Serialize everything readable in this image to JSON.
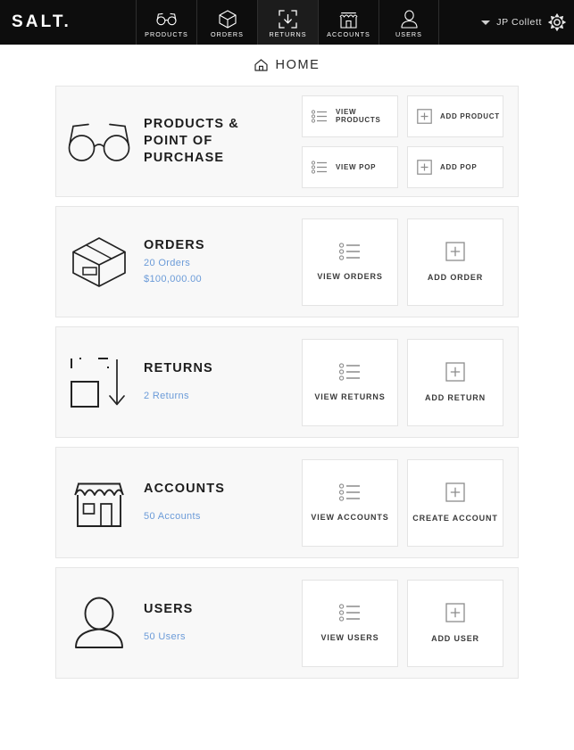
{
  "topnav": {
    "logo": "SALT.",
    "items": [
      {
        "label": "PRODUCTS",
        "icon": "glasses-icon",
        "active": false
      },
      {
        "label": "ORDERS",
        "icon": "box-icon",
        "active": false
      },
      {
        "label": "RETURNS",
        "icon": "return-box-icon",
        "active": true
      },
      {
        "label": "ACCOUNTS",
        "icon": "storefront-icon",
        "active": false
      },
      {
        "label": "USERS",
        "icon": "person-icon",
        "active": false
      }
    ],
    "username": "JP Collett",
    "settings_icon": "gear-icon",
    "chevron_icon": "chevron-down-icon"
  },
  "breadcrumb": {
    "icon": "home-icon",
    "label": "HOME"
  },
  "cards": {
    "products": {
      "title": "PRODUCTS & POINT OF PURCHASE",
      "icon": "glasses-icon",
      "actions": [
        {
          "label": "VIEW PRODUCTS",
          "icon": "list-icon"
        },
        {
          "label": "ADD PRODUCT",
          "icon": "plus-box-icon"
        },
        {
          "label": "VIEW POP",
          "icon": "list-icon"
        },
        {
          "label": "ADD POP",
          "icon": "plus-box-icon"
        }
      ]
    },
    "orders": {
      "title": "ORDERS",
      "icon": "box-icon",
      "stat1": "20 Orders",
      "stat2": "$100,000.00",
      "actions": [
        {
          "label": "VIEW ORDERS",
          "icon": "list-icon"
        },
        {
          "label": "ADD ORDER",
          "icon": "plus-box-icon"
        }
      ]
    },
    "returns": {
      "title": "RETURNS",
      "icon": "return-box-icon",
      "stat1": "2 Returns",
      "actions": [
        {
          "label": "VIEW RETURNS",
          "icon": "list-icon"
        },
        {
          "label": "ADD RETURN",
          "icon": "plus-box-icon"
        }
      ]
    },
    "accounts": {
      "title": "ACCOUNTS",
      "icon": "storefront-icon",
      "stat1": "50 Accounts",
      "actions": [
        {
          "label": "VIEW ACCOUNTS",
          "icon": "list-icon"
        },
        {
          "label": "CREATE ACCOUNT",
          "icon": "plus-box-icon"
        }
      ]
    },
    "users": {
      "title": "USERS",
      "icon": "person-icon",
      "stat1": "50 Users",
      "actions": [
        {
          "label": "VIEW USERS",
          "icon": "list-icon"
        },
        {
          "label": "ADD USER",
          "icon": "plus-box-icon"
        }
      ]
    }
  },
  "colors": {
    "nav_background": "#0d0d0d",
    "nav_active": "#1c1c1c",
    "card_background": "#f8f8f8",
    "card_border": "#e6e6e6",
    "tile_background": "#ffffff",
    "link_blue": "#6b9bd8",
    "text_dark": "#1d1d1d"
  }
}
